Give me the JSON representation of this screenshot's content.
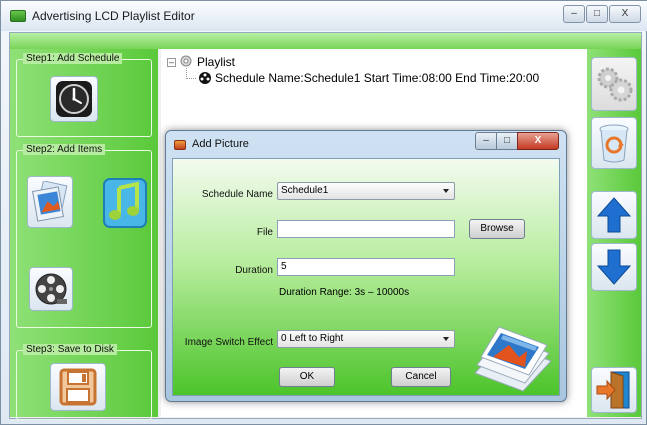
{
  "app": {
    "title": "Advertising LCD Playlist Editor",
    "minimize": "–",
    "maximize": "□",
    "close": "X"
  },
  "sidebar": {
    "step1": "Step1: Add Schedule",
    "step2": "Step2: Add Items",
    "step3": "Step3: Save to Disk"
  },
  "tree": {
    "root": "Playlist",
    "expander": "–",
    "child": "Schedule Name:Schedule1  Start Time:08:00  End Time:20:00"
  },
  "dialog": {
    "title": "Add Picture",
    "min": "–",
    "max": "□",
    "close": "X",
    "schedule_label": "Schedule Name",
    "schedule_value": "Schedule1",
    "file_label": "File",
    "file_value": "",
    "browse": "Browse",
    "duration_label": "Duration",
    "duration_value": "5",
    "duration_range": "Duration Range: 3s – 10000s",
    "effect_label": "Image Switch Effect",
    "effect_value": "0 Left to Right",
    "ok": "OK",
    "cancel": "Cancel"
  },
  "colors": {
    "panel_green": "#5ac93a",
    "panel_green_light": "#8fe177",
    "arrow_blue": "#1f6fd0",
    "door_orange": "#e8762a"
  }
}
